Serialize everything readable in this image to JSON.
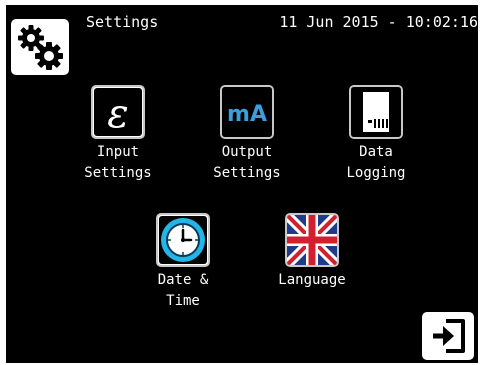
{
  "header": {
    "title": "Settings",
    "datetime": "11 Jun 2015 - 10:02:16",
    "settings_icon": "gears-icon"
  },
  "tiles": [
    {
      "label": "Input\nSettings",
      "icon": "epsilon-icon"
    },
    {
      "label": "Output\nSettings",
      "icon": "milliamp-icon",
      "icon_text": "mA"
    },
    {
      "label": "Data\nLogging",
      "icon": "sd-card-icon"
    },
    {
      "label": "Date &\nTime",
      "icon": "clock-icon"
    },
    {
      "label": "Language",
      "icon": "union-jack-icon"
    }
  ],
  "footer": {
    "exit_icon": "exit-icon"
  },
  "colors": {
    "background": "#000000",
    "text": "#ffffff",
    "ma_blue": "#3aa0dc",
    "clock_blue": "#22b6e8"
  }
}
